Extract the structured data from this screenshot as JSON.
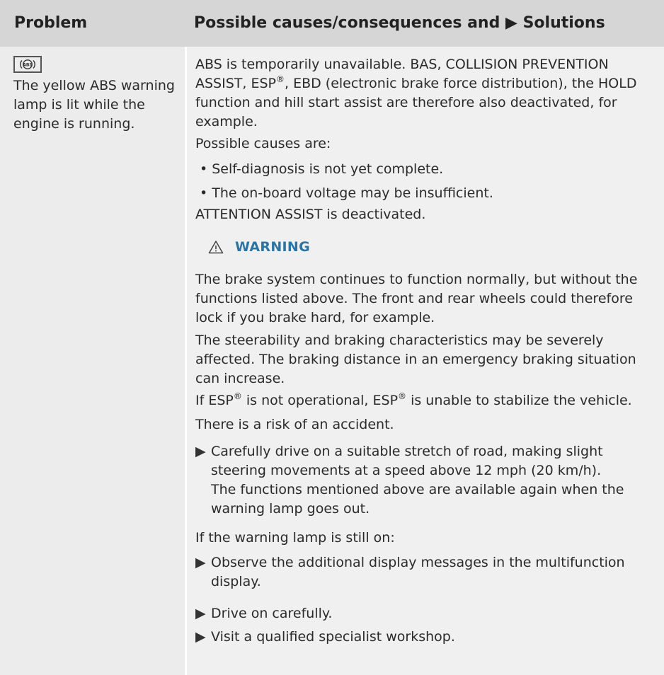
{
  "header": {
    "col1": "Problem",
    "col2": "Possible causes/consequences and ▶ Solutions"
  },
  "problem": {
    "icon": "abs-warning-lamp-icon",
    "text": "The yellow ABS warning lamp is lit while the engine is running."
  },
  "solution": {
    "intro_line1": "ABS is temporarily unavailable. BAS, COLLISION PREVENTION",
    "intro_line2_a": "ASSIST, ESP",
    "intro_line2_b": ", EBD (electronic brake force distribution), the HOLD",
    "intro_line3": "function and hill start assist are therefore also deactivated, for",
    "intro_line4": "example.",
    "causes_label": "Possible causes are:",
    "causes": [
      "• Self-diagnosis is not yet complete.",
      "• The on-board voltage may be insufficient."
    ],
    "attention": "ATTENTION ASSIST is deactivated.",
    "warning_label": "WARNING",
    "warn_p1_l1": "The brake system continues to function normally, but without the",
    "warn_p1_l2": "functions listed above. The front and rear wheels could therefore",
    "warn_p1_l3": "lock if you brake hard, for example.",
    "warn_p2_l1": "The steerability and braking characteristics may be severely",
    "warn_p2_l2": "affected. The braking distance in an emergency braking situation",
    "warn_p2_l3": "can increase.",
    "warn_p3_a": "If ESP",
    "warn_p3_b": " is not operational, ESP",
    "warn_p3_c": " is unable to stabilize the vehicle.",
    "reg": "®",
    "risk": "There is a risk of an accident.",
    "action1_l1": "Carefully drive on a suitable stretch of road, making slight",
    "action1_l2": "steering movements at a speed above 12 mph (20 km/h).",
    "action1_l3": "The functions mentioned above are available again when the",
    "action1_l4": "warning lamp goes out.",
    "still_on": "If the warning lamp is still on:",
    "action2_l1": "Observe the additional display messages in the multifunction",
    "action2_l2": "display.",
    "action3": "Drive on carefully.",
    "action4": "Visit a qualified specialist workshop.",
    "action_marker": "▶"
  },
  "colors": {
    "header_bg": "#d6d6d6",
    "body_bg": "#f0f0f0",
    "warning_blue": "#2a73a5"
  }
}
